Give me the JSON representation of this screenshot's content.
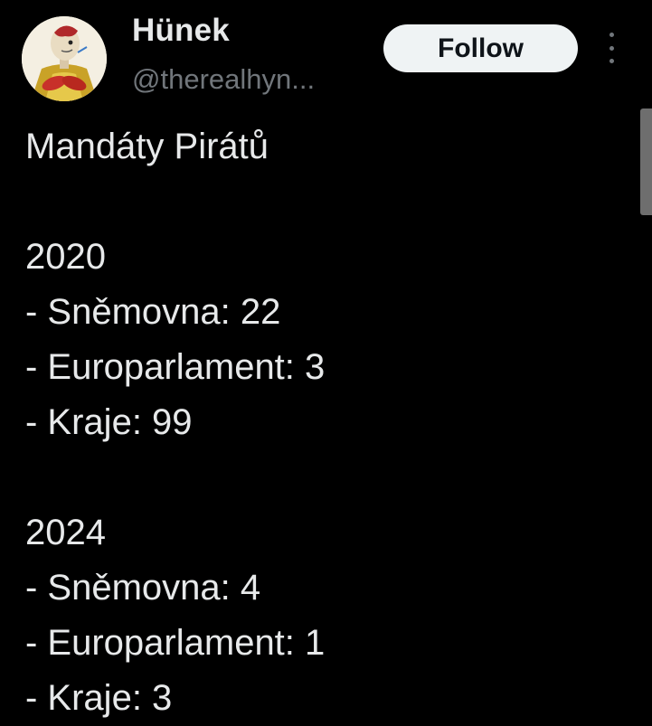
{
  "author": {
    "display_name": "Hünek",
    "handle": "@therealhyn..."
  },
  "actions": {
    "follow_label": "Follow",
    "more_icon": "more-vertical-icon"
  },
  "tweet": {
    "title": "Mandáty Pirátů",
    "sections": [
      {
        "year": "2020",
        "items": [
          "- Sněmovna: 22",
          "- Europarlament: 3",
          "- Kraje: 99"
        ]
      },
      {
        "year": "2024",
        "items": [
          "- Sněmovna: 4",
          "- Europarlament: 1",
          "- Kraje: 3"
        ]
      }
    ]
  },
  "colors": {
    "background": "#000000",
    "text": "#e7e9ea",
    "secondary_text": "#71767b",
    "follow_button_bg": "#eff3f4",
    "follow_button_text": "#0f1419"
  }
}
